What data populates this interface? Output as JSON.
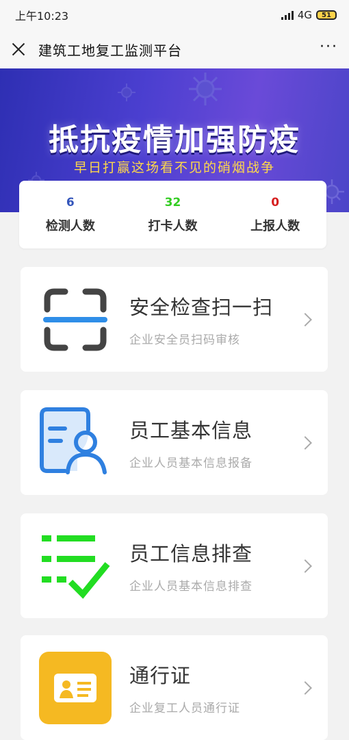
{
  "status_bar": {
    "time": "上午10:23",
    "network": "4G",
    "battery": "51"
  },
  "nav": {
    "title": "建筑工地复工监测平台",
    "more": "···"
  },
  "banner": {
    "title": "抵抗疫情加强防疫",
    "subtitle": "早日打赢这场看不见的硝烟战争"
  },
  "stats": [
    {
      "value": "6",
      "label": "检测人数",
      "color": "#3355bb"
    },
    {
      "value": "32",
      "label": "打卡人数",
      "color": "#33cc22"
    },
    {
      "value": "0",
      "label": "上报人数",
      "color": "#d62020"
    }
  ],
  "menu": [
    {
      "title": "安全检查扫一扫",
      "subtitle": "企业安全员扫码审核",
      "icon": "scan-icon"
    },
    {
      "title": "员工基本信息",
      "subtitle": "企业人员基本信息报备",
      "icon": "employee-info-icon"
    },
    {
      "title": "员工信息排查",
      "subtitle": "企业人员基本信息排查",
      "icon": "checklist-icon"
    },
    {
      "title": "通行证",
      "subtitle": "企业复工人员通行证",
      "icon": "pass-card-icon"
    }
  ]
}
